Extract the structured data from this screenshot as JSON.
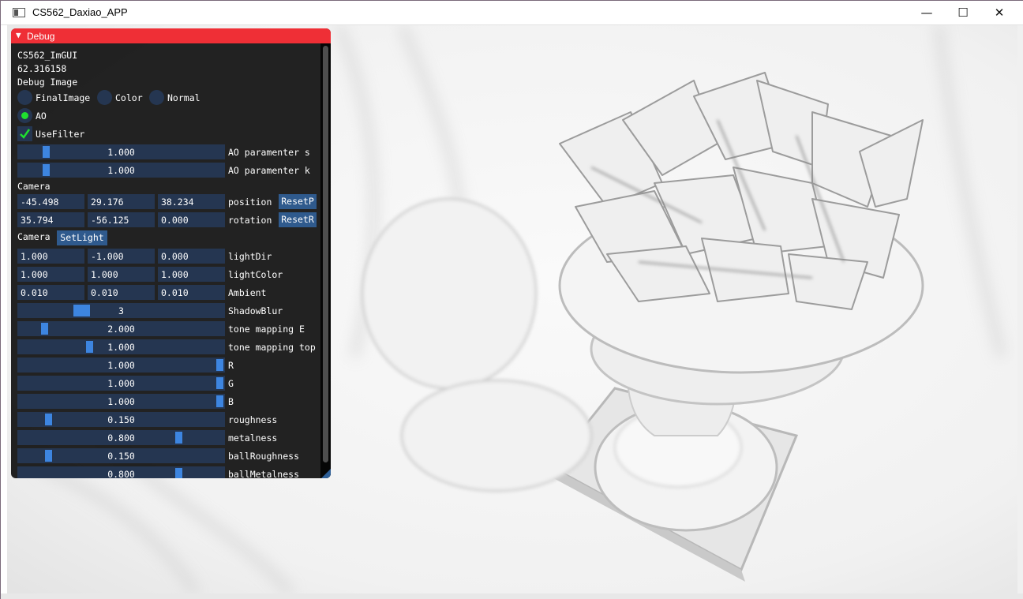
{
  "window": {
    "title": "CS562_Daxiao_APP",
    "min_glyph": "—",
    "max_glyph": "☐",
    "close_glyph": "✕"
  },
  "debug": {
    "header": "Debug",
    "app_name": "CS562_ImGUI",
    "fps": "62.316158",
    "debug_image_label": "Debug Image",
    "modes": [
      "FinalImage",
      "Color",
      "Normal",
      "AO"
    ],
    "selected_mode": "AO",
    "use_filter": {
      "label": "UseFilter",
      "checked": true
    },
    "ao_s": {
      "value": "1.000",
      "label": "AO paramenter s",
      "fraction": 0.12
    },
    "ao_k": {
      "value": "1.000",
      "label": "AO paramenter k",
      "fraction": 0.12
    },
    "camera_label": "Camera",
    "position": {
      "values": [
        "-45.498",
        "29.176",
        "38.234"
      ],
      "label": "position",
      "button": "ResetP"
    },
    "rotation": {
      "values": [
        "35.794",
        "-56.125",
        "0.000"
      ],
      "label": "rotation",
      "button": "ResetR"
    },
    "camera_label2": "Camera",
    "set_light_button": "SetLight",
    "lightDir": {
      "values": [
        "1.000",
        "-1.000",
        "0.000"
      ],
      "label": "lightDir"
    },
    "lightColor": {
      "values": [
        "1.000",
        "1.000",
        "1.000"
      ],
      "label": "lightColor"
    },
    "ambient": {
      "values": [
        "0.010",
        "0.010",
        "0.010"
      ],
      "label": "Ambient"
    },
    "shadowBlur": {
      "value": "3",
      "label": "ShadowBlur",
      "fraction": 0.29
    },
    "toneE": {
      "value": "2.000",
      "label": "tone mapping E",
      "fraction": 0.11
    },
    "toneTop": {
      "value": "1.000",
      "label": "tone mapping top",
      "fraction": 0.34
    },
    "R": {
      "value": "1.000",
      "label": "R",
      "fraction": 1.0
    },
    "G": {
      "value": "1.000",
      "label": "G",
      "fraction": 1.0
    },
    "B": {
      "value": "1.000",
      "label": "B",
      "fraction": 1.0
    },
    "roughness": {
      "value": "0.150",
      "label": "roughness",
      "fraction": 0.13
    },
    "metalness": {
      "value": "0.800",
      "label": "metalness",
      "fraction": 0.79
    },
    "ballRoughness": {
      "value": "0.150",
      "label": "ballRoughness",
      "fraction": 0.13
    },
    "ballMetalness": {
      "value": "0.800",
      "label": "ballMetalness",
      "fraction": 0.79
    }
  },
  "colors": {
    "header_red": "#ef2f36",
    "frame_blue": "#253651",
    "grab_blue": "#3d85e0",
    "button_blue": "#2f5a8d",
    "active_green": "#1fe02f"
  }
}
